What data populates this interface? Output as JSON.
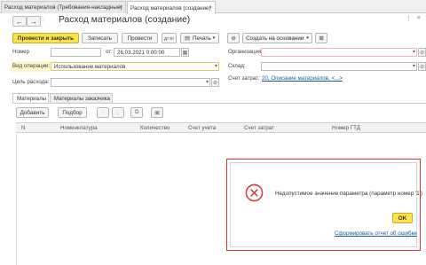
{
  "tabs": [
    {
      "label": "Расход материалов (Требования-накладные)"
    },
    {
      "label": "Расход материалов (создание)"
    }
  ],
  "nav": {
    "back": "←",
    "forward": "→",
    "star": "☆"
  },
  "title": "Расход материалов (создание)",
  "toolbar": {
    "post_close": "Провести и закрыть",
    "save": "Записать",
    "post": "Провести",
    "dt_kt": "Дт Кт",
    "print": "Печать",
    "create_based": "Создать на основании"
  },
  "form": {
    "number_label": "Номер",
    "number_value": "",
    "from_label": "от:",
    "date_value": "26.03.2021  0:00:00",
    "org_label": "Организация:",
    "org_value": "",
    "operation_label": "Вид операции:",
    "operation_value": "Использование материалов",
    "warehouse_label": "Склад:",
    "warehouse_value": "",
    "purpose_label": "Цель расхода:",
    "purpose_value": "",
    "cost_account_label": "Счет затрат:",
    "cost_account_value": "20, Описание материалов, <...>"
  },
  "subtabs": [
    "Материалы",
    "Материалы заказчика"
  ],
  "table_toolbar": {
    "add": "Добавить",
    "pick": "Подбор"
  },
  "table": {
    "columns": [
      "N",
      "Номенклатура",
      "Количество",
      "Счет учета",
      "Счет затрат",
      "Номер ГТД"
    ]
  },
  "dialog": {
    "message": "Недопустимое значение параметра (параметр номер '1')",
    "ok": "OK",
    "report_link": "Сформировать отчет об ошибке"
  },
  "colors": {
    "accent": "#fbe24b",
    "error": "#dd3333",
    "link": "#1a5a9e"
  }
}
